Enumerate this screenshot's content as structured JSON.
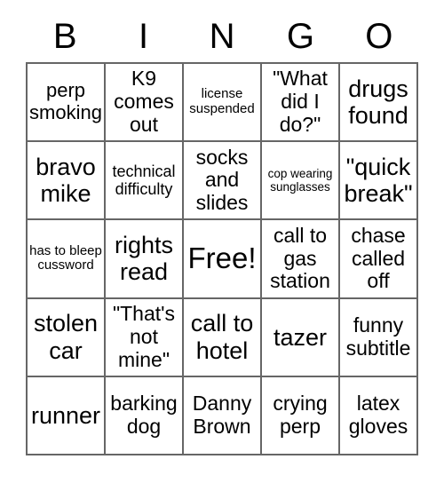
{
  "card": {
    "header_letters": [
      "B",
      "I",
      "N",
      "G",
      "O"
    ],
    "free_space_label": "Free!",
    "grid_size": "5x5",
    "border_color": "#666666",
    "text_color": "#000000",
    "background_color": "#ffffff",
    "rows": [
      [
        {
          "text": "perp smoking",
          "size": "md"
        },
        {
          "text": "K9 comes out",
          "size": "md"
        },
        {
          "text": "license suspended",
          "size": "xs"
        },
        {
          "text": "\"What did I do?\"",
          "size": "md"
        },
        {
          "text": "drugs found",
          "size": "lg"
        }
      ],
      [
        {
          "text": "bravo mike",
          "size": "lg"
        },
        {
          "text": "technical difficulty",
          "size": "sm"
        },
        {
          "text": "socks and slides",
          "size": "md"
        },
        {
          "text": "cop wearing sunglasses",
          "size": "xxs"
        },
        {
          "text": "\"quick break\"",
          "size": "lg"
        }
      ],
      [
        {
          "text": "has to bleep cussword",
          "size": "xs"
        },
        {
          "text": "rights read",
          "size": "lg"
        },
        {
          "text": "Free!",
          "size": "xl"
        },
        {
          "text": "call to gas station",
          "size": "md"
        },
        {
          "text": "chase called off",
          "size": "md"
        }
      ],
      [
        {
          "text": "stolen car",
          "size": "lg"
        },
        {
          "text": "\"That's not mine\"",
          "size": "md"
        },
        {
          "text": "call to hotel",
          "size": "lg"
        },
        {
          "text": "tazer",
          "size": "lg"
        },
        {
          "text": "funny subtitle",
          "size": "md"
        }
      ],
      [
        {
          "text": "runner",
          "size": "lg"
        },
        {
          "text": "barking dog",
          "size": "md"
        },
        {
          "text": "Danny Brown",
          "size": "md"
        },
        {
          "text": "crying perp",
          "size": "md"
        },
        {
          "text": "latex gloves",
          "size": "md"
        }
      ]
    ]
  }
}
